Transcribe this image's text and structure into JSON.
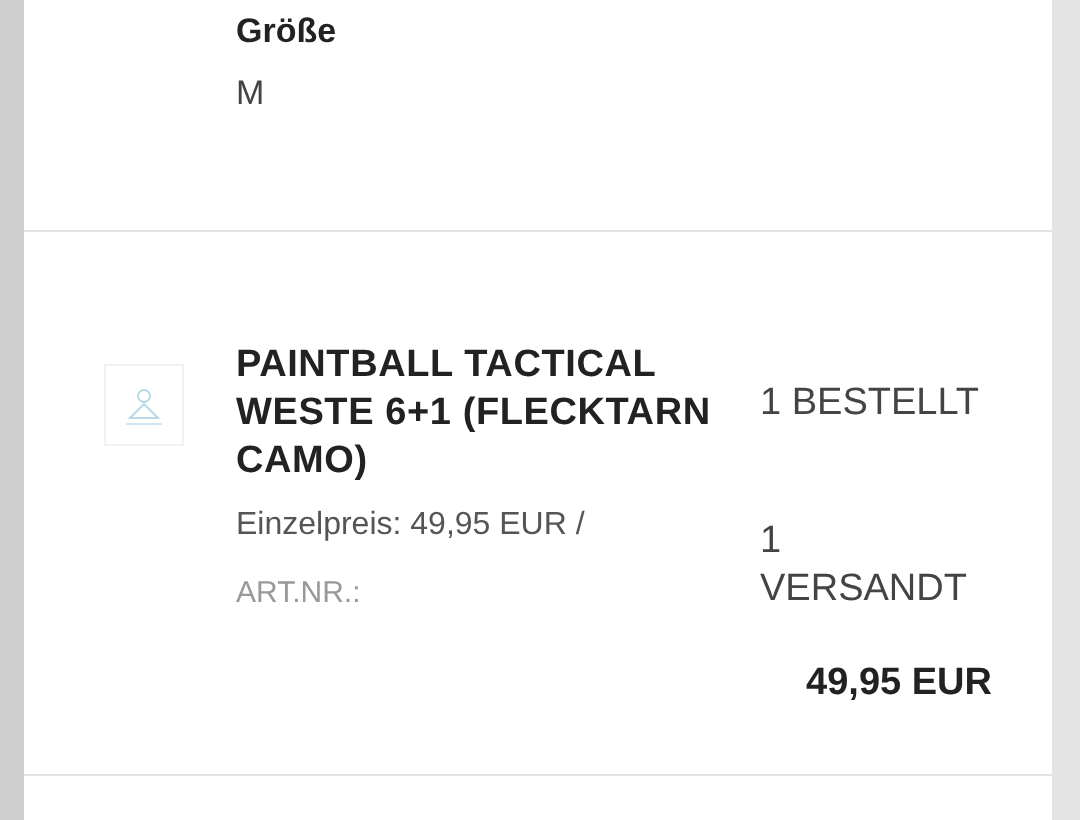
{
  "option": {
    "label": "Größe",
    "value": "M"
  },
  "items": [
    {
      "title": "PAINTBALL TACTICAL WESTE 6+1 (FLECKTARN CAMO)",
      "unit_price": "Einzelpreis: 49,95 EUR /",
      "article_number": "ART.NR.:",
      "ordered": "1 BESTELLT",
      "shipped": "1 VERSANDT",
      "total": "49,95 EUR"
    }
  ]
}
